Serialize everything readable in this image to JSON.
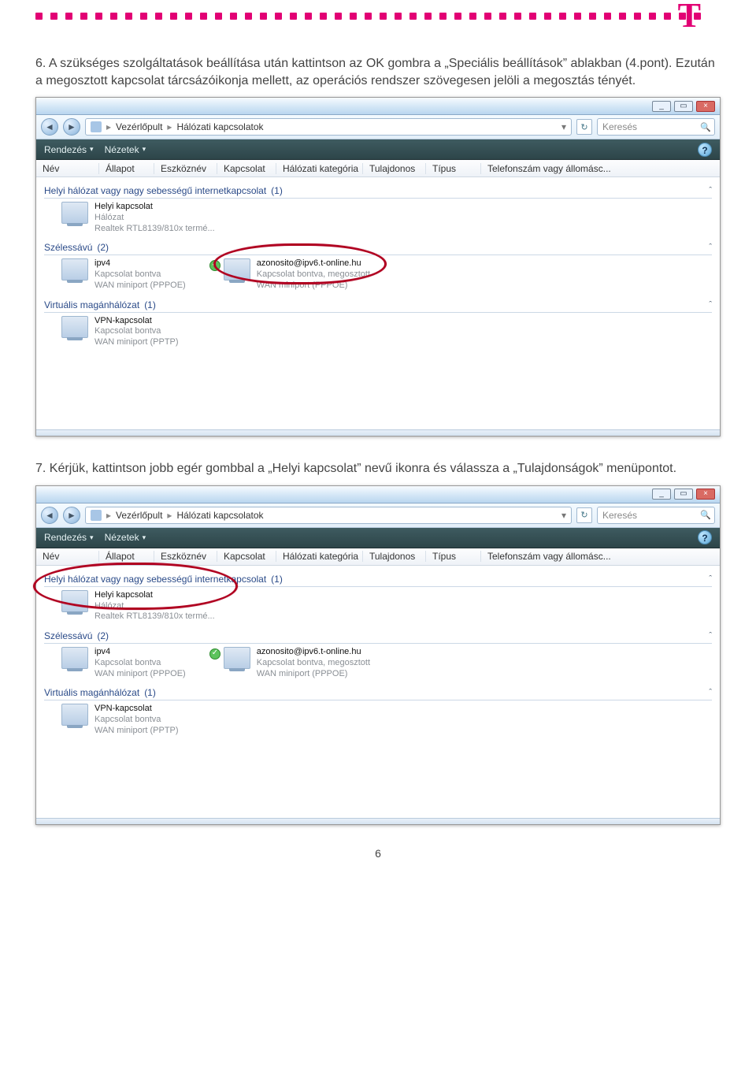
{
  "top": {
    "t_glyph": "T"
  },
  "para6": "6. A szükséges szolgáltatások beállítása után kattintson az OK gombra a „Speciális beállítások” ablakban (4.pont). Ezután a megosztott kapcsolat tárcsázóikonja mellett, az operációs rendszer szövegesen jelöli a megosztás tényét.",
  "para7": "7. Kérjük, kattintson jobb egér gombbal a „Helyi kapcsolat” nevű ikonra és válassza a „Tulajdonságok” menüpontot.",
  "page_number": "6",
  "win": {
    "title_btn_min": "_",
    "title_btn_max": "▭",
    "title_btn_close": "×",
    "nav_back": "◄",
    "nav_fwd": "►",
    "breadcrumb_root": "Vezérlőpult",
    "breadcrumb_leaf": "Hálózati kapcsolatok",
    "breadcrumb_sep": "▸",
    "addr_drop": "▾",
    "refresh": "↻",
    "search_placeholder": "Keresés",
    "toolbar": {
      "organize": "Rendezés",
      "views": "Nézetek",
      "arrow": "▾",
      "help": "?"
    },
    "cols": {
      "c1": "Név",
      "c2": "Állapot",
      "c3": "Eszköznév",
      "c4": "Kapcsolat",
      "c5": "Hálózati kategória",
      "c6": "Tulajdonos",
      "c7": "Típus",
      "c8": "Telefonszám vagy állomásc..."
    },
    "collapse_glyph": "ˆ",
    "groups": {
      "g1": {
        "label": "Helyi hálózat vagy nagy sebességű internetkapcsolat",
        "count": "(1)"
      },
      "g2": {
        "label": "Szélessávú",
        "count": "(2)"
      },
      "g3": {
        "label": "Virtuális magánhálózat",
        "count": "(1)"
      }
    },
    "conn": {
      "c1": {
        "t": "Helyi kapcsolat",
        "s1": "Hálózat",
        "s2": "Realtek RTL8139/810x termé..."
      },
      "c2": {
        "t": "ipv4",
        "s1": "Kapcsolat bontva",
        "s2": "WAN miniport (PPPOE)"
      },
      "c3": {
        "t": "azonosito@ipv6.t-online.hu",
        "s1": "Kapcsolat bontva, megosztott",
        "s2": "WAN miniport (PPPOE)"
      },
      "c4": {
        "t": "VPN-kapcsolat",
        "s1": "Kapcsolat bontva",
        "s2": "WAN miniport (PPTP)"
      }
    }
  }
}
